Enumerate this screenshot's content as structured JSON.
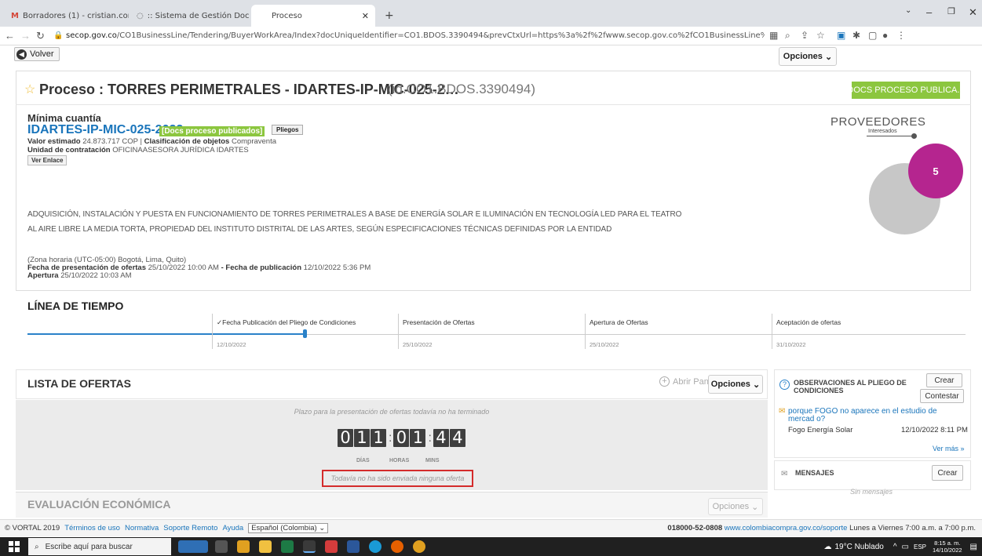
{
  "browser": {
    "tabs": [
      {
        "title": "Borradores (1) - cristian.correa@",
        "icon": "gmail-icon",
        "active": false
      },
      {
        "title": ":: Sistema de Gestión Document",
        "icon": "document-system-icon",
        "active": false
      },
      {
        "title": "Proceso",
        "icon": "",
        "active": true
      }
    ],
    "new_tab": "+",
    "url_host": "secop.gov.co",
    "url_path": "/CO1BusinessLine/Tendering/BuyerWorkArea/Index?docUniqueIdentifier=CO1.BDOS.3390494&prevCtxUrl=https%3a%2f%2fwww.secop.gov.co%2fCO1BusinessLine%2fTendering%2fBuyerDossierWorkspace%2fIndex%3fcreate..."
  },
  "header": {
    "back_label": "Volver",
    "options_label": "Opciones"
  },
  "process": {
    "title": "Proceso : TORRES PERIMETRALES - IDARTES-IP-MIC-025-2…",
    "id": "(id.CO1.BDOS.3390494)",
    "status_badge": "DOCS PROCESO PUBLICA...",
    "modality": "Mínima cuantía",
    "reference": "IDARTES-IP-MIC-025-2022",
    "reference_badge": "[Docs proceso publicados]",
    "pliegos_label": "Pliegos",
    "valor_label": "Valor estimado",
    "valor": "24.873.717 COP",
    "clasif_label": "Clasificación de objetos",
    "clasif": "Compraventa",
    "unidad_label": "Unidad de contratación",
    "unidad": "OFICINAASESORA JURÍDICA IDARTES",
    "ver_enlace": "Ver Enlace",
    "desc_line1": "ADQUISICIÓN, INSTALACIÓN Y PUESTA EN FUNCIONAMIENTO DE TORRES PERIMETRALES A BASE DE ENERGÍA SOLAR E ILUMINACIÓN EN TECNOLOGÍA LED PARA EL TEATRO",
    "desc_line2": "AL AIRE LIBRE LA MEDIA TORTA, PROPIEDAD DEL INSTITUTO DISTRITAL DE LAS ARTES, SEGÚN ESPECIFICACIONES TÉCNICAS DEFINIDAS POR LA ENTIDAD",
    "timezone": "(Zona horaria (UTC-05:00) Bogotá, Lima, Quito)",
    "fecha_pres_label": "Fecha de presentación de ofertas",
    "fecha_pres": "25/10/2022 10:00 AM",
    "fecha_pub_sep": "-",
    "fecha_pub_label": "Fecha de publicación",
    "fecha_pub": "12/10/2022 5:36 PM",
    "apertura_label": "Apertura",
    "apertura": "25/10/2022 10:03 AM"
  },
  "providers": {
    "title": "PROVEEDORES",
    "subtitle": "Interesados",
    "count": "5"
  },
  "timeline": {
    "title": "LÍNEA DE TIEMPO",
    "steps": [
      {
        "label": "✓Fecha Publicación del Pliego de Condiciones",
        "date": "12/10/2022"
      },
      {
        "label": "Presentación de Ofertas",
        "date": "25/10/2022"
      },
      {
        "label": "Apertura de Ofertas",
        "date": "25/10/2022"
      },
      {
        "label": "Aceptación de ofertas",
        "date": "31/10/2022"
      }
    ]
  },
  "offers": {
    "title": "LISTA DE OFERTAS",
    "open_panel": "Abrir Panel",
    "options_label": "Opciones",
    "deadline_note": "Plazo para la presentación de ofertas todavía no ha terminado",
    "countdown": {
      "days": [
        "0",
        "1",
        "1"
      ],
      "hours": [
        "0",
        "1"
      ],
      "mins": [
        "4",
        "4"
      ],
      "sep": ":"
    },
    "labels": {
      "days": "DÍAS",
      "hours": "HORAS",
      "mins": "MINS"
    },
    "no_offer": "Todavía no ha sido enviada ninguna oferta"
  },
  "evaluation": {
    "title": "EVALUACIÓN ECONÓMICA",
    "options_label": "Opciones"
  },
  "observations": {
    "title": "OBSERVACIONES AL PLIEGO DE CONDICIONES",
    "create": "Crear",
    "reply": "Contestar",
    "item_text": "porque FOGO no aparece en el estudio de mercad o?",
    "item_user": "Fogo Energía Solar",
    "item_date": "12/10/2022 8:11 PM",
    "see_more": "Ver más »"
  },
  "messages": {
    "title": "MENSAJES",
    "create": "Crear",
    "empty": "Sin mensajes"
  },
  "footer": {
    "copyright": "© VORTAL 2019",
    "links": [
      "Términos de uso",
      "Normativa",
      "Soporte Remoto",
      "Ayuda"
    ],
    "language": "Español (Colombia)",
    "phone": "018000-52-0808",
    "support_url": "www.colombiacompra.gov.co/soporte",
    "hours": "Lunes a Viernes 7:00 a.m. a 7:00 p.m."
  },
  "taskbar": {
    "search_placeholder": "Escribe aquí para buscar",
    "weather": "19°C Nublado",
    "lang": "ESP",
    "time": "8:15 a. m.",
    "date": "14/10/2022"
  },
  "colors": {
    "brand_blue": "#1a75bb",
    "green_badge": "#8cc63f",
    "provider_pink": "#b5258f",
    "highlight_red": "#d42b2b"
  }
}
